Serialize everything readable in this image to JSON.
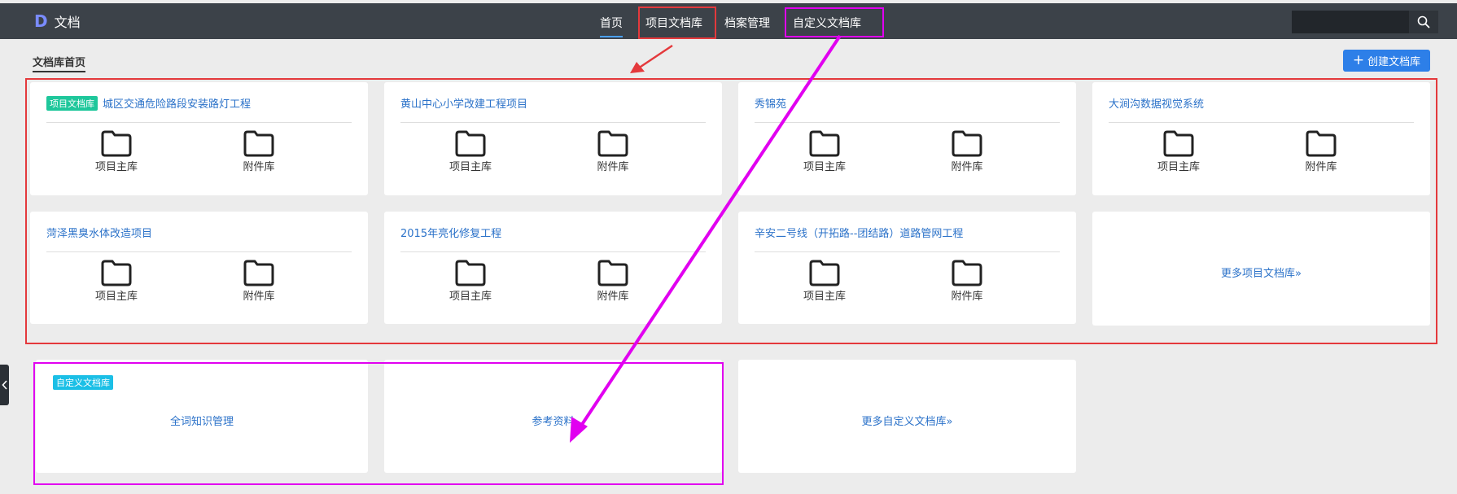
{
  "app": {
    "logo_letter": "D",
    "title": "文档"
  },
  "nav": {
    "items": [
      {
        "label": "首页",
        "active": true
      },
      {
        "label": "项目文档库",
        "active": false
      },
      {
        "label": "档案管理",
        "active": false
      },
      {
        "label": "自定义文档库",
        "active": false
      }
    ]
  },
  "search": {
    "placeholder": "",
    "icon": "search-icon"
  },
  "breadcrumb": "文档库首页",
  "create_button": {
    "label": "创建文档库",
    "icon": "plus-icon"
  },
  "project_libraries": {
    "tag": "项目文档库",
    "folder_labels": [
      "项目主库",
      "附件库"
    ],
    "cards": [
      {
        "title": "城区交通危险路段安装路灯工程"
      },
      {
        "title": "黄山中心小学改建工程项目"
      },
      {
        "title": "秀锦苑"
      },
      {
        "title": "大涧沟数据视觉系统"
      },
      {
        "title": "菏泽黑臭水体改造项目"
      },
      {
        "title": "2015年亮化修复工程"
      },
      {
        "title": "辛安二号线（开拓路--团结路）道路管网工程"
      }
    ],
    "more_link": "更多项目文档库»"
  },
  "custom_libraries": {
    "tag": "自定义文档库",
    "cards": [
      {
        "title": "全词知识管理"
      },
      {
        "title": "参考资料"
      }
    ],
    "more_link": "更多自定义文档库»"
  },
  "colors": {
    "topbar": "#3c4249",
    "link": "#2b72c9",
    "primary_button": "#2d7fe8",
    "tag_green": "#1ec79b",
    "tag_cyan": "#1bbfe6",
    "annotation_red": "#e4393c",
    "annotation_magenta": "#e100f0"
  }
}
